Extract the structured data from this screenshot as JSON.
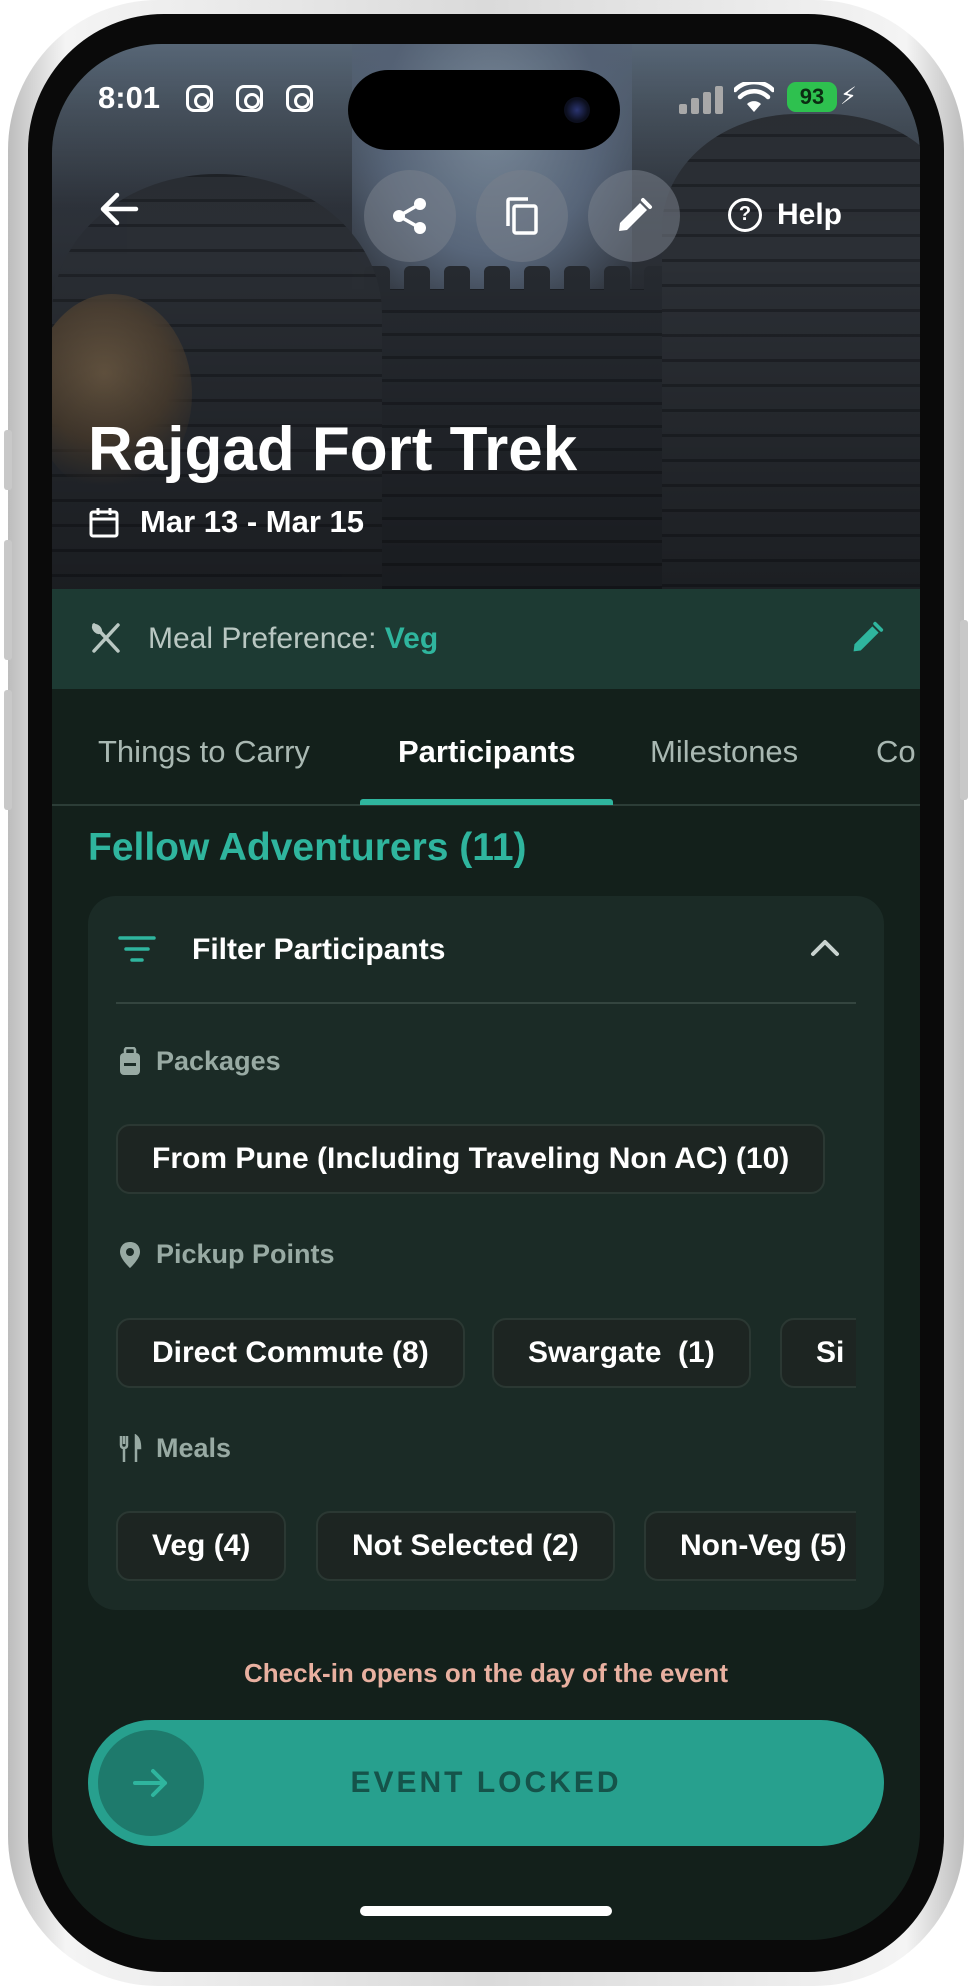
{
  "status_bar": {
    "time": "8:01",
    "battery": "93"
  },
  "header": {
    "help_label": "Help"
  },
  "event": {
    "title": "Rajgad Fort Trek",
    "dates": "Mar 13 - Mar 15"
  },
  "meal_preference": {
    "label": "Meal Preference: ",
    "value": "Veg"
  },
  "tabs": [
    {
      "label": "Things to Carry"
    },
    {
      "label": "Participants"
    },
    {
      "label": "Milestones"
    },
    {
      "label": "Co"
    }
  ],
  "active_tab": "Participants",
  "section": {
    "title": "Fellow Adventurers (11)"
  },
  "filter": {
    "title": "Filter Participants",
    "groups": {
      "packages": {
        "label": "Packages",
        "chips": [
          "From Pune (Including Traveling Non AC) (10)"
        ]
      },
      "pickup_points": {
        "label": "Pickup Points",
        "chips": [
          "Direct Commute (8)",
          "Swargate  (1)",
          "Si"
        ]
      },
      "meals": {
        "label": "Meals",
        "chips": [
          "Veg (4)",
          "Not Selected (2)",
          "Non-Veg (5)"
        ]
      }
    }
  },
  "checkin_note": "Check-in opens on the day of the event",
  "locked_button": {
    "label": "EVENT LOCKED"
  },
  "colors": {
    "accent": "#2fb59e",
    "background": "#13201b",
    "meal_bar": "#1d3a33",
    "card": "#1b2b26",
    "note": "#e8b0a0",
    "locked_button": "#27a08e"
  }
}
